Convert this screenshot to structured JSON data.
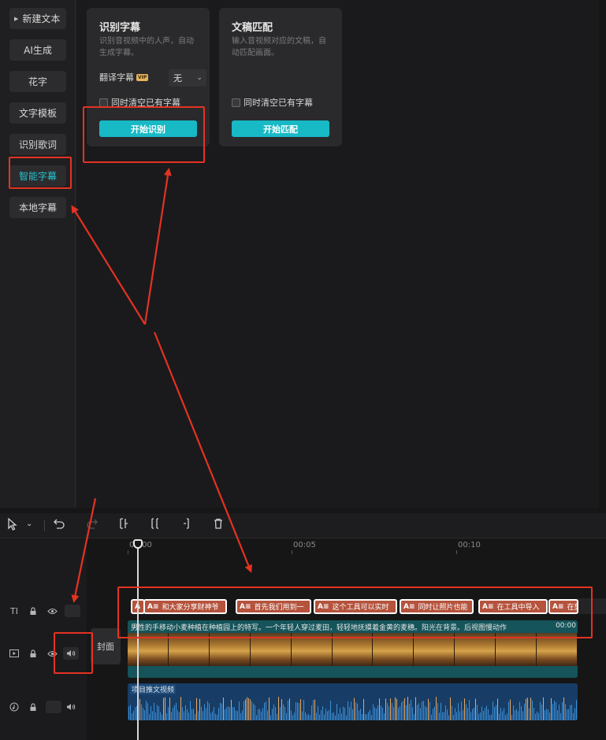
{
  "sidebar": {
    "items": [
      {
        "label": "新建文本",
        "active": false
      },
      {
        "label": "AI生成",
        "active": false
      },
      {
        "label": "花字",
        "active": false
      },
      {
        "label": "文字模板",
        "active": false
      },
      {
        "label": "识别歌词",
        "active": false
      },
      {
        "label": "智能字幕",
        "active": true
      },
      {
        "label": "本地字幕",
        "active": false
      }
    ]
  },
  "recognize_card": {
    "title": "识别字幕",
    "description": "识别音视频中的人声，自动生成字幕。",
    "translate_label": "翻译字幕",
    "vip_badge": "VIP",
    "language_value": "无",
    "clear_label": "同时清空已有字幕",
    "button_label": "开始识别"
  },
  "match_card": {
    "title": "文稿匹配",
    "description": "输入音视频对应的文稿，自动匹配画面。",
    "clear_label": "同时清空已有字幕",
    "button_label": "开始匹配"
  },
  "ruler": {
    "labels": [
      "00:00",
      "00:05",
      "00:10"
    ]
  },
  "tracks": {
    "cover_label": "封面",
    "text_clips": [
      {
        "text": ""
      },
      {
        "text": "和大家分享财神爷"
      },
      {
        "text": "首先我们用到一"
      },
      {
        "text": "这个工具可以实时"
      },
      {
        "text": "同时让照片也能"
      },
      {
        "text": "在工具中导入"
      },
      {
        "text": "在剪"
      }
    ],
    "video_caption": "男性的手移动小麦种植在种植园上的特写。一个年轻人穿过麦田，轻轻地抚摸着金黄的麦穗。阳光在背景。后视图慢动作",
    "video_duration": "00:00",
    "audio_label": "项目推文视频"
  },
  "colors": {
    "accent": "#17b9c5",
    "active_text": "#22c5cf",
    "annotation_red": "#e53222",
    "text_clip": "#b5533d",
    "video_track": "#14545a",
    "audio_track": "#173d66"
  }
}
